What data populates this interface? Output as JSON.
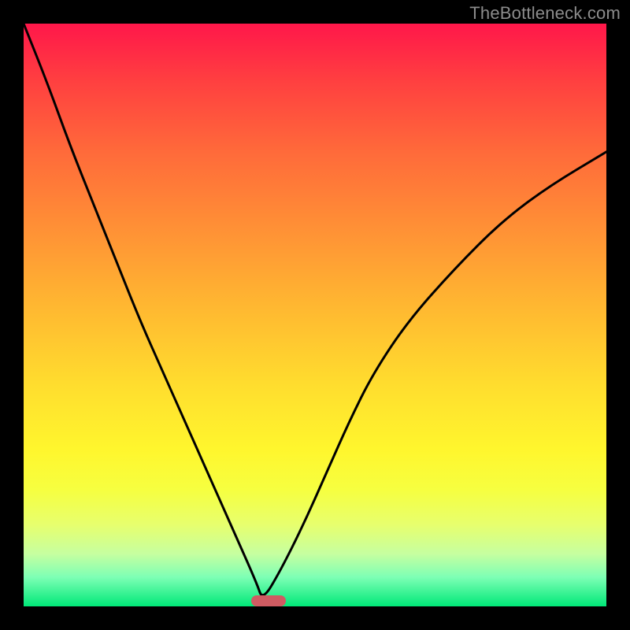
{
  "watermark": "TheBottleneck.com",
  "colors": {
    "frame": "#000000",
    "curve": "#000000",
    "marker": "#cf5b62",
    "gradient_top": "#ff174a",
    "gradient_bottom": "#00e878"
  },
  "chart_data": {
    "type": "line",
    "title": "",
    "xlabel": "",
    "ylabel": "",
    "xlim": [
      0,
      100
    ],
    "ylim": [
      0,
      100
    ],
    "grid": false,
    "note": "V-shaped bottleneck curve with minimum around x≈41; values estimated from pixel positions (axes are unlabeled).",
    "series": [
      {
        "name": "bottleneck-curve",
        "x": [
          0,
          4,
          8,
          12,
          16,
          20,
          24,
          28,
          32,
          36,
          40,
          41,
          44,
          48,
          52,
          56,
          60,
          66,
          74,
          82,
          90,
          100
        ],
        "y": [
          100,
          90,
          79,
          69,
          59,
          49,
          40,
          31,
          22,
          13,
          4,
          1,
          6,
          14,
          23,
          32,
          40,
          49,
          58,
          66,
          72,
          78
        ]
      }
    ],
    "marker": {
      "x_start": 39,
      "x_end": 45,
      "y": 0.5,
      "label": ""
    }
  }
}
